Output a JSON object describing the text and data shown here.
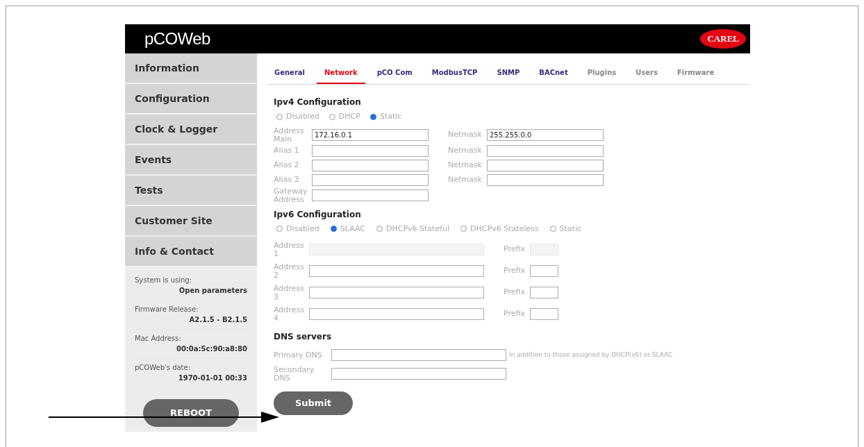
{
  "header": {
    "logo": "pCOWeb",
    "brand": "CAREL"
  },
  "sidebar": {
    "items": [
      {
        "label": "Information"
      },
      {
        "label": "Configuration"
      },
      {
        "label": "Clock & Logger"
      },
      {
        "label": "Events"
      },
      {
        "label": "Tests"
      },
      {
        "label": "Customer Site"
      },
      {
        "label": "Info & Contact"
      }
    ],
    "info": [
      {
        "label": "System is using:",
        "value": "Open parameters"
      },
      {
        "label": "Firmware Release:",
        "value": "A2.1.5 - B2.1.5"
      },
      {
        "label": "Mac Address:",
        "value": "00:0a:5c:90:a8:80"
      },
      {
        "label": "pCOWeb's date:",
        "value": "1970-01-01 00:33"
      }
    ],
    "reboot_button": "REBOOT"
  },
  "tabs": [
    {
      "label": "General",
      "selected": false
    },
    {
      "label": "Network",
      "selected": true
    },
    {
      "label": "pCO Com",
      "selected": false
    },
    {
      "label": "ModbusTCP",
      "selected": false
    },
    {
      "label": "SNMP",
      "selected": false
    },
    {
      "label": "BACnet",
      "selected": false
    },
    {
      "label": "Plugins",
      "selected": false
    },
    {
      "label": "Users",
      "selected": false
    },
    {
      "label": "Firmware",
      "selected": false
    }
  ],
  "ipv4": {
    "title": "Ipv4 Configuration",
    "modes": [
      {
        "label": "Disabled",
        "selected": false
      },
      {
        "label": "DHCP",
        "selected": false
      },
      {
        "label": "Static",
        "selected": true
      }
    ],
    "rows": [
      {
        "label": "Address Main",
        "value": "172.16.0.1",
        "netmask_label": "Netmask",
        "netmask": "255.255.0.0"
      },
      {
        "label": "Alias 1",
        "netmask_label": "Netmask"
      },
      {
        "label": "Alias 2",
        "netmask_label": "Netmask"
      },
      {
        "label": "Alias 3",
        "netmask_label": "Netmask"
      },
      {
        "label": "Gateway Address"
      }
    ]
  },
  "ipv6": {
    "title": "Ipv6 Configuration",
    "modes": [
      {
        "label": "Disabled",
        "selected": false
      },
      {
        "label": "SLAAC",
        "selected": true
      },
      {
        "label": "DHCPv6 Stateful",
        "selected": false
      },
      {
        "label": "DHCPv6 Stateless",
        "selected": false
      },
      {
        "label": "Static",
        "selected": false
      }
    ],
    "rows": [
      {
        "label": "Address 1",
        "prefix_label": "Prefix",
        "disabled": true
      },
      {
        "label": "Address 2",
        "prefix_label": "Prefix",
        "disabled": false
      },
      {
        "label": "Address 3",
        "prefix_label": "Prefix",
        "disabled": false
      },
      {
        "label": "Address 4",
        "prefix_label": "Prefix",
        "disabled": false
      }
    ]
  },
  "dns": {
    "title": "DNS servers",
    "rows": [
      {
        "label": "Primary DNS",
        "note": "In addition to those assigned by DHCP(v6) or SLAAC"
      },
      {
        "label": "Secondary DNS"
      }
    ]
  },
  "submit_button": "Submit"
}
